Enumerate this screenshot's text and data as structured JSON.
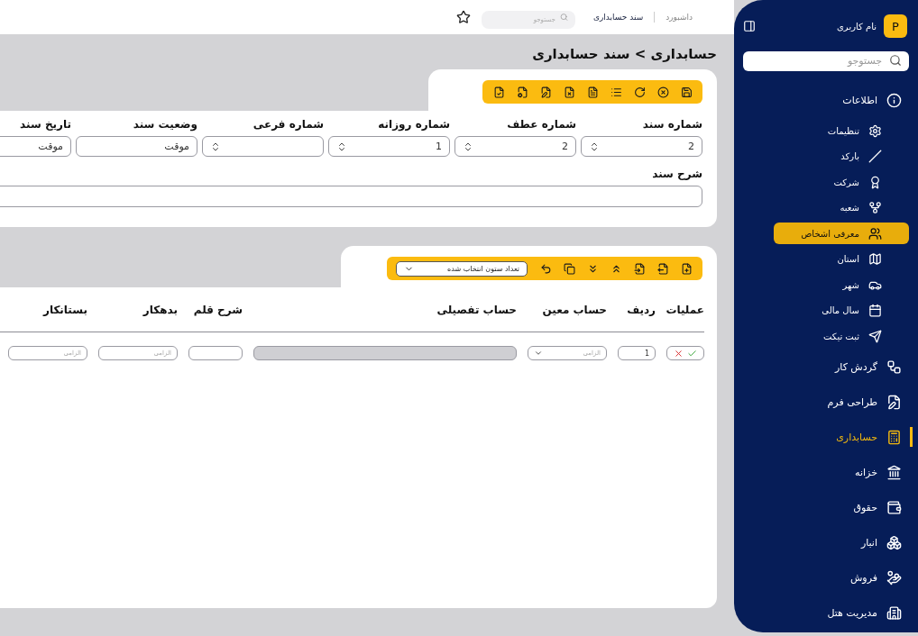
{
  "breadcrumb": [
    {
      "label": "داشبورد",
      "selected": false
    },
    {
      "label": "سند حسابداری",
      "selected": true
    }
  ],
  "top_search": {
    "placeholder": "جستوجو"
  },
  "page_title": "حسابداری > سند حسابداری",
  "fields": [
    {
      "label": "شماره سند",
      "value": "2",
      "kind": "spinner"
    },
    {
      "label": "شماره عطف",
      "value": "2",
      "kind": "spinner"
    },
    {
      "label": "شماره روزانه",
      "value": "1",
      "kind": "spinner"
    },
    {
      "label": "شماره فرعی",
      "kind": "spinner"
    },
    {
      "label": "وضعیت سند",
      "value": "موقت",
      "kind": "text"
    },
    {
      "label": "تاریخ سند",
      "value": "موقت",
      "kind": "text"
    }
  ],
  "description": {
    "label": "شرح سند"
  },
  "grid": {
    "column_picker": "تعداد ستون انتخاب شده",
    "columns": [
      "عملیات",
      "ردیف",
      "حساب معین",
      "حساب تفصیلی",
      "شرح قلم",
      "بدهکار",
      "بستانکار"
    ],
    "rows": [
      {
        "row": "1",
        "account_placeholder": "الزامی",
        "debit_placeholder": "الزامی",
        "credit_placeholder": "الزامی"
      }
    ]
  },
  "sidebar": {
    "avatar": "P",
    "user_name": "نام کاربری",
    "search": {
      "placeholder": "جستوجو"
    },
    "items": [
      {
        "label": "اطلاعات",
        "selected": false,
        "children": [
          {
            "label": "تنظیمات",
            "selected": false
          },
          {
            "label": "بارکد",
            "selected": false
          },
          {
            "label": "شرکت",
            "selected": false
          },
          {
            "label": "شعبه",
            "selected": false
          },
          {
            "label": "معرفی اشخاص",
            "selected": true
          },
          {
            "label": "استان",
            "selected": false
          },
          {
            "label": "شهر",
            "selected": false
          },
          {
            "label": "سال مالی",
            "selected": false
          },
          {
            "label": "ثبت تیکت",
            "selected": false
          }
        ]
      },
      {
        "label": "گردش کار",
        "selected": false
      },
      {
        "label": "طراحی فرم",
        "selected": false
      },
      {
        "label": "حسابداری",
        "selected": true
      },
      {
        "label": "خزانه",
        "selected": false
      },
      {
        "label": "حقوق",
        "selected": false
      },
      {
        "label": "انبار",
        "selected": false
      },
      {
        "label": "فروش",
        "selected": false
      },
      {
        "label": "مدیریت هتل",
        "selected": false
      }
    ]
  }
}
